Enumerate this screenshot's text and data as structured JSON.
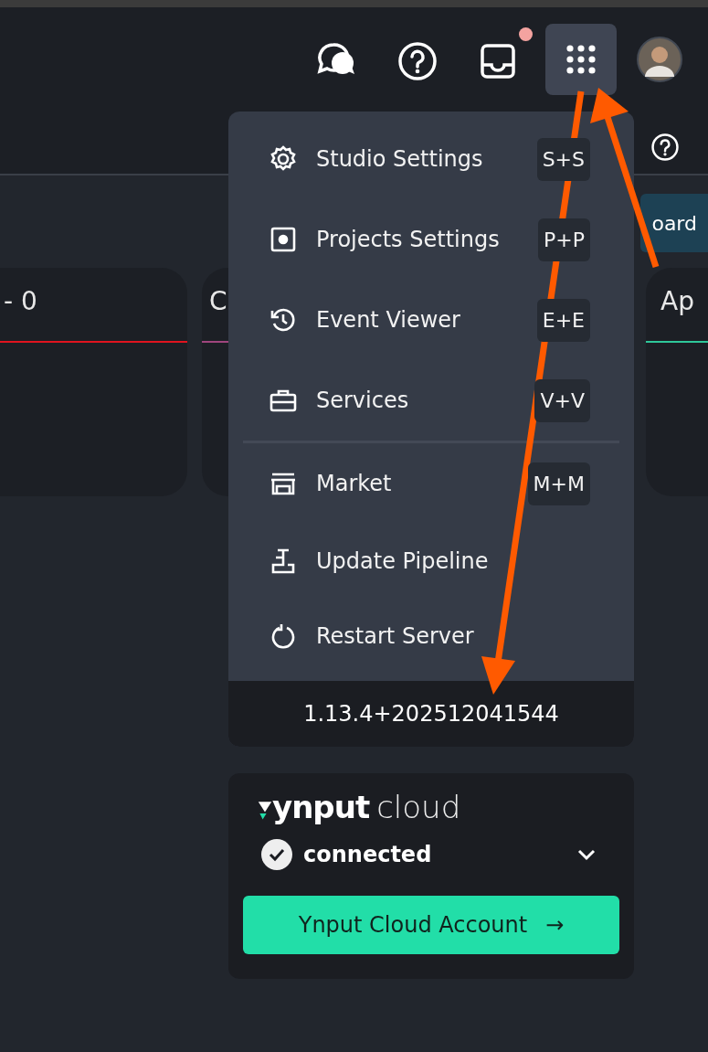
{
  "header": {
    "inbox": {
      "has_notification": true
    },
    "apps_button": {
      "selected": true
    }
  },
  "toolbar": {
    "button": "oard"
  },
  "cards": [
    {
      "title": "- 0",
      "color": "#e0141e"
    },
    {
      "title": "C",
      "color": "#a0457e"
    },
    {
      "title": "Ap",
      "color": "#2ec79a"
    }
  ],
  "menu": {
    "groups": [
      [
        {
          "kind": "gear",
          "label": "Studio Settings",
          "shortcut": "S+S"
        },
        {
          "kind": "project",
          "label": "Projects Settings",
          "shortcut": "P+P"
        },
        {
          "kind": "history",
          "label": "Event Viewer",
          "shortcut": "E+E"
        },
        {
          "kind": "toolbox",
          "label": "Services",
          "shortcut": "V+V"
        }
      ],
      [
        {
          "kind": "store",
          "label": "Market",
          "shortcut": "M+M"
        },
        {
          "kind": "pipeline",
          "label": "Update Pipeline"
        },
        {
          "kind": "restart",
          "label": "Restart Server"
        }
      ]
    ],
    "version": "1.13.4+202512041544"
  },
  "cloud": {
    "logo": "ynput",
    "logo_suffix": "cloud",
    "status": "connected",
    "connected": true,
    "button": "Ynput Cloud Account",
    "button_arrow": "→"
  }
}
